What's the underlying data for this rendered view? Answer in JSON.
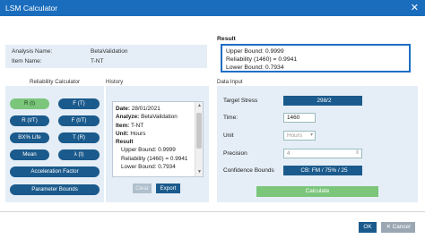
{
  "window": {
    "title": "LSM Calculator",
    "close_glyph": "✕"
  },
  "analysis": {
    "name_label": "Analysis Name:",
    "name_value": "BetaValidation",
    "item_label": "Item Name:",
    "item_value": "T-NT"
  },
  "result": {
    "label": "Result",
    "lines": [
      "Upper Bound: 0.9999",
      "Reliability (1460) = 0.9941",
      "Lower Bound: 0.7934"
    ]
  },
  "reliability_calculator": {
    "label": "Reliability Calculator",
    "buttons": {
      "r_t": "R (t)",
      "f_t": "F (T)",
      "r_tt": "R (t/T)",
      "f_tt": "F (t/T)",
      "bx_life": "BX% Life",
      "t_r": "T (R)",
      "mean": "Mean",
      "lambda_t": "λ (t)",
      "acceleration_factor": "Acceleration Factor",
      "parameter_bounds": "Parameter Bounds"
    }
  },
  "history": {
    "label": "History",
    "date_label": "Date:",
    "date_value": "28/01/2021",
    "analyze_label": "Analyze:",
    "analyze_value": "BetaValidation",
    "item_label": "Item:",
    "item_value": "T-NT",
    "unit_label": "Unit:",
    "unit_value": "Hours",
    "result_label": "Result",
    "upper": "Upper Bound: 0.9999",
    "reliability": "Reliability (1460) = 0.9941",
    "lower": "Lower Bound: 0.7934",
    "clear_label": "Clear",
    "export_label": "Export"
  },
  "data_input": {
    "label": "Data Input",
    "target_stress_label": "Target Stress",
    "target_stress_value": "298/2",
    "time_label": "Time:",
    "time_value": "1460",
    "unit_label": "Unit",
    "unit_value": "Hours",
    "precision_label": "Precision",
    "precision_value": "4",
    "confidence_label": "Confidence Bounds",
    "confidence_value": "CB: FM / 75% / 25",
    "calculate_label": "Calculate"
  },
  "footer": {
    "ok_label": "OK",
    "cancel_label": "✕ Cancel"
  },
  "colors": {
    "accent": "#1a6dbd",
    "button": "#1b5a8c",
    "active": "#7bc67b",
    "panel": "#e5eef7"
  }
}
